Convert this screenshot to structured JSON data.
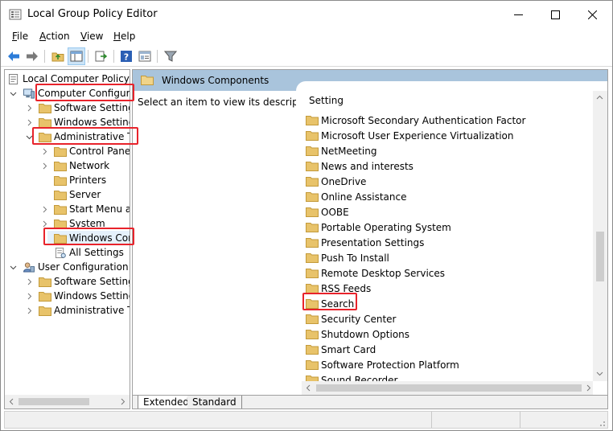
{
  "window": {
    "title": "Local Group Policy Editor"
  },
  "menu": {
    "file": {
      "key": "F",
      "rest": "ile"
    },
    "action": {
      "key": "A",
      "rest": "ction"
    },
    "view": {
      "key": "V",
      "rest": "iew"
    },
    "help": {
      "key": "H",
      "rest": "elp"
    }
  },
  "toolbar": {
    "icons": [
      "back-arrow-icon",
      "forward-arrow-icon",
      "up-folder-icon",
      "show-hide-tree-icon",
      "export-list-icon",
      "help-icon",
      "properties-icon",
      "filter-icon"
    ]
  },
  "tree": {
    "root": "Local Computer Policy",
    "computer_config": "Computer Configura",
    "cc_software": "Software Settings",
    "cc_windows": "Windows Setting",
    "cc_admin": "Administrative Te",
    "control_panel": "Control Panel",
    "network": "Network",
    "printers": "Printers",
    "server": "Server",
    "start_menu": "Start Menu ar",
    "system": "System",
    "windows_components": "Windows Cor",
    "all_settings": "All Settings",
    "user_config": "User Configuration",
    "uc_software": "Software Settings",
    "uc_windows": "Windows Setting",
    "uc_admin": "Administrative Te"
  },
  "details": {
    "header": "Windows Components",
    "description": "Select an item to view its description.",
    "column_setting": "Setting",
    "items": [
      "Microsoft Secondary Authentication Factor",
      "Microsoft User Experience Virtualization",
      "NetMeeting",
      "News and interests",
      "OneDrive",
      "Online Assistance",
      "OOBE",
      "Portable Operating System",
      "Presentation Settings",
      "Push To Install",
      "Remote Desktop Services",
      "RSS Feeds",
      "Search",
      "Security Center",
      "Shutdown Options",
      "Smart Card",
      "Software Protection Platform",
      "Sound Recorder"
    ]
  },
  "tabs": {
    "extended": "Extended",
    "standard": "Standard"
  },
  "colors": {
    "highlight_box": "#e8232b",
    "header_band": "#a9c4dc",
    "folder": "#e8c36a"
  }
}
